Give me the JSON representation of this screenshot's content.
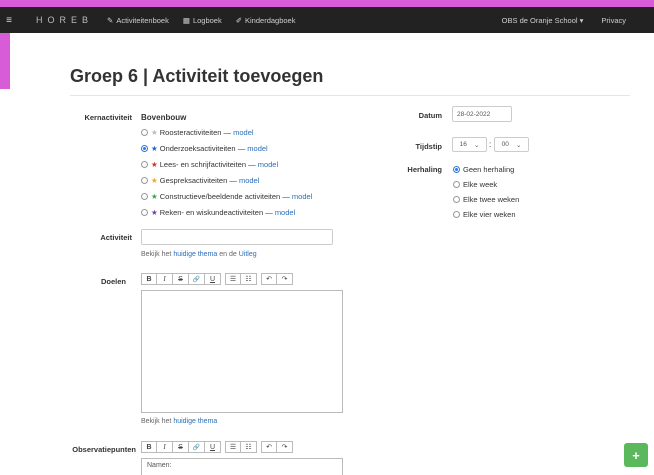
{
  "nav": {
    "brand": "HOREB",
    "items": [
      {
        "label": "Activiteitenboek",
        "icon": "book-icon"
      },
      {
        "label": "Logboek",
        "icon": "calendar-icon"
      },
      {
        "label": "Kinderdagboek",
        "icon": "pencil-icon"
      }
    ],
    "school": "OBS de Oranje School",
    "school_caret": "▾",
    "privacy": "Privacy"
  },
  "page": {
    "title": "Groep 6 | Activiteit toevoegen"
  },
  "kern": {
    "label": "Kernactiviteit",
    "group": "Bovenbouw",
    "options": [
      {
        "text": "Roosteractiviteiten",
        "link": "model",
        "star_color": "#bbbbbb",
        "selected": false
      },
      {
        "text": "Onderzoeksactiviteiten",
        "link": "model",
        "star_color": "#2a5fd1",
        "selected": true
      },
      {
        "text": "Lees- en schrijfactiviteiten",
        "link": "model",
        "star_color": "#d9302c",
        "selected": false
      },
      {
        "text": "Gespreksactiviteiten",
        "link": "model",
        "star_color": "#f0a81c",
        "selected": false
      },
      {
        "text": "Constructieve/beeldende activiteiten",
        "link": "model",
        "star_color": "#3aa84a",
        "selected": false
      },
      {
        "text": "Reken- en wiskundeactiviteiten",
        "link": "model",
        "star_color": "#7a3bb0",
        "selected": false
      }
    ],
    "separator": "—"
  },
  "activiteit": {
    "label": "Activiteit",
    "value": "",
    "hint_prefix": "Bekijk het",
    "hint_link1": "huidige thema",
    "hint_mid": "en de",
    "hint_link2": "Uitleg"
  },
  "doelen": {
    "label": "Doelen",
    "hint_prefix": "Bekijk het",
    "hint_link": "huidige thema"
  },
  "toolbar": {
    "bold": "B",
    "italic": "I",
    "strike": "S",
    "link": "🔗",
    "underline": "U",
    "ul": "☰",
    "ol": "☷",
    "undo": "↶",
    "redo": "↷"
  },
  "observatie": {
    "label": "Observatiepunten",
    "placeholder_line": "Namen:"
  },
  "datum": {
    "label": "Datum",
    "value": "28-02-2022"
  },
  "tijdstip": {
    "label": "Tijdstip",
    "hour": "16",
    "minute": "00",
    "colon": ":",
    "caret": "⌄"
  },
  "herhaling": {
    "label": "Herhaling",
    "options": [
      {
        "text": "Geen herhaling",
        "selected": true
      },
      {
        "text": "Elke week",
        "selected": false
      },
      {
        "text": "Elke twee weken",
        "selected": false
      },
      {
        "text": "Elke vier weken",
        "selected": false
      }
    ]
  },
  "fab": {
    "label": "+"
  }
}
